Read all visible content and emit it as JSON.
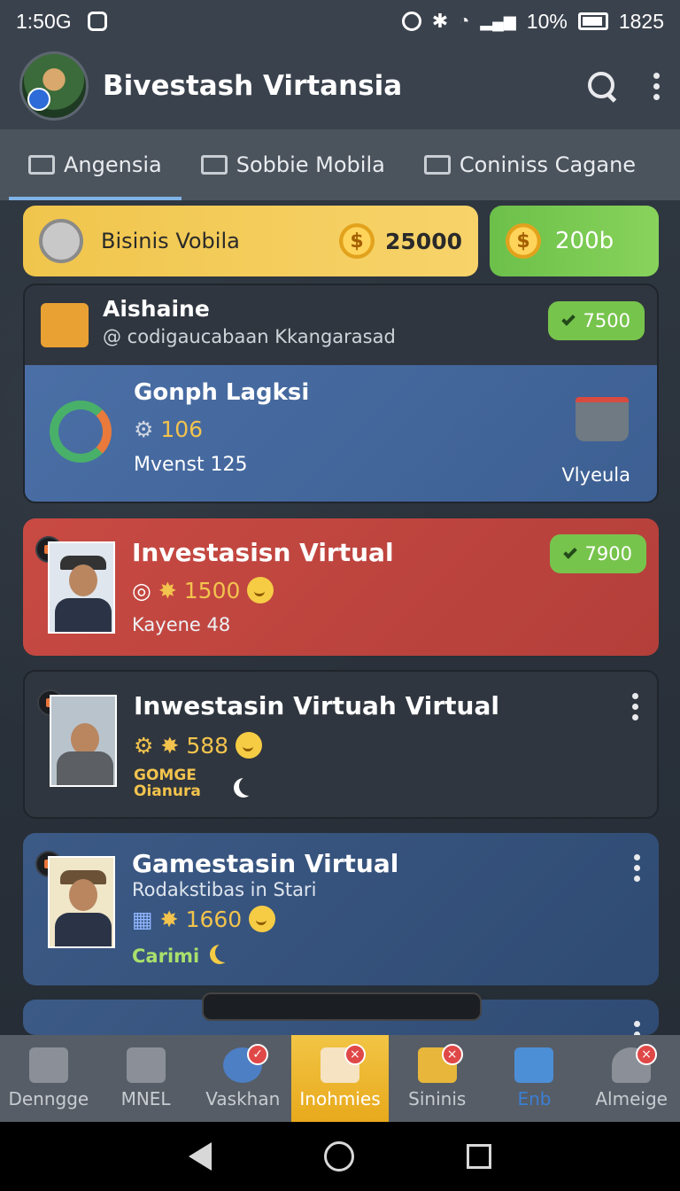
{
  "status_bar": {
    "time": "1:50G",
    "battery_percent": "10%",
    "clock": "1825"
  },
  "app_bar": {
    "title": "Bivestash Virtansia"
  },
  "tabs": [
    {
      "label": "Angensia",
      "active": true
    },
    {
      "label": "Sobbie Mobila",
      "active": false
    },
    {
      "label": "Coniniss Cagane",
      "active": false
    }
  ],
  "balance": {
    "label": "Bisinis Vobila",
    "amount": "25000",
    "secondary_amount": "200b"
  },
  "cards": [
    {
      "title": "Aishaine",
      "subtitle": "@ codigaucabaan Kkangarasad",
      "pill": "7500",
      "inner": {
        "title": "Gonph Lagksi",
        "value": "106",
        "detail": "Mvenst 125",
        "action": "Vlyeula"
      }
    },
    {
      "title": "Investasisn Virtual",
      "value": "1500",
      "detail": "Kayene 48",
      "pill": "7900"
    },
    {
      "title": "Inwestasin Virtuah Virtual",
      "value": "588",
      "tag_line1": "GOMGE",
      "tag_line2": "Oianura"
    },
    {
      "title": "Gamestasin Virtual",
      "subtitle": "Rodakstibas in Stari",
      "value": "1660",
      "detail": "Carimi"
    }
  ],
  "bottom_nav": [
    {
      "label": "Denngge",
      "active": false
    },
    {
      "label": "MNEL",
      "active": false
    },
    {
      "label": "Vaskhan",
      "active": false
    },
    {
      "label": "Inohmies",
      "active": true
    },
    {
      "label": "Sininis",
      "active": false
    },
    {
      "label": "Enb",
      "active": false
    },
    {
      "label": "Almeige",
      "active": false
    }
  ],
  "colors": {
    "accent_gold": "#f2c545",
    "accent_green": "#77c44d",
    "card_red": "#c84a43",
    "card_blue": "#3c5a86"
  }
}
